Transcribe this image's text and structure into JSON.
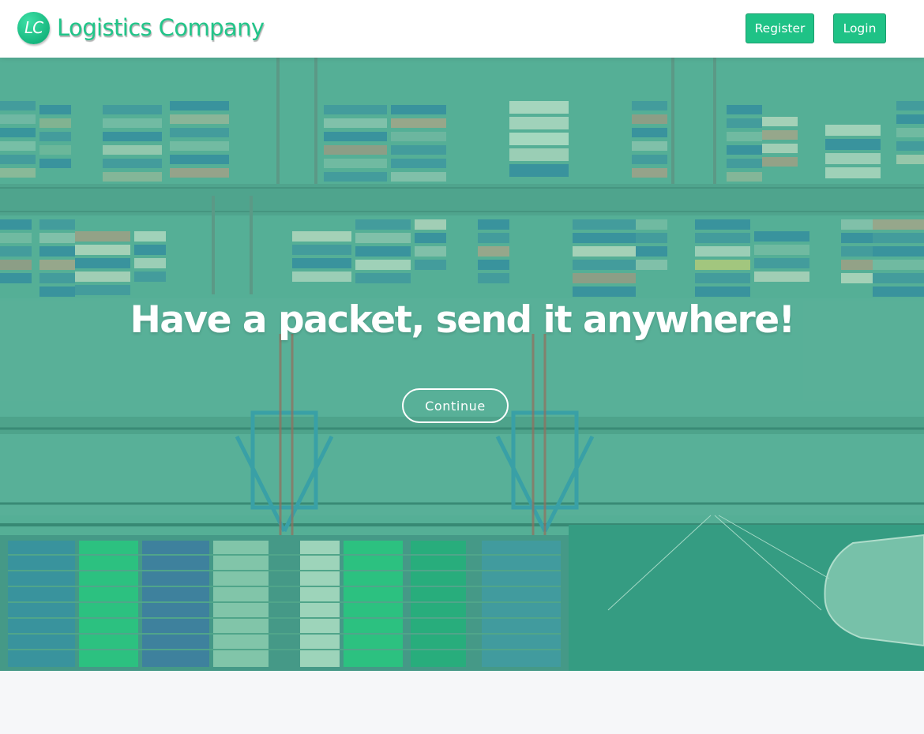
{
  "brand": {
    "logo_initials": "LC",
    "name": "Logistics Company"
  },
  "nav": {
    "register_label": "Register",
    "login_label": "Login"
  },
  "hero": {
    "headline": "Have a packet, send it anywhere!",
    "cta_label": "Continue",
    "image_icon": "container-port-aerial-photo"
  },
  "colors": {
    "accent": "#1fc286",
    "accent_border": "#1b9e6e",
    "hero_tint": "#5da797",
    "page_background": "#f6f7f9"
  }
}
